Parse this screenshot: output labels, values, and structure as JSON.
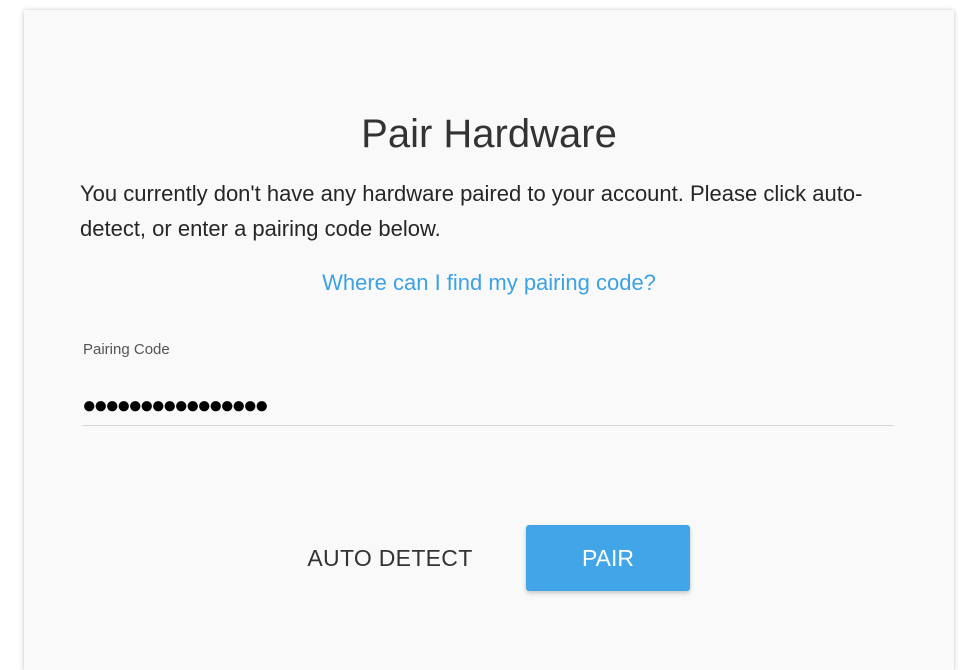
{
  "dialog": {
    "title": "Pair Hardware",
    "description": "You currently don't have any hardware paired to your account. Please click auto-detect, or enter a pairing code below.",
    "help_link": "Where can I find my pairing code?",
    "pairing_field": {
      "label": "Pairing Code",
      "value": "●●●●●●●●●●●●●●●●"
    },
    "buttons": {
      "auto_detect": "AUTO DETECT",
      "pair": "PAIR"
    }
  },
  "colors": {
    "accent": "#42a5e8",
    "link": "#3ca2e3",
    "dialog_background": "#f9f9f9"
  }
}
